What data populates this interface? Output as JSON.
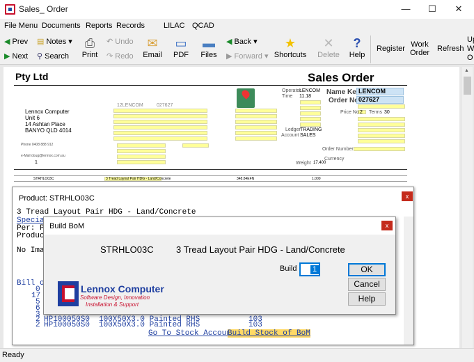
{
  "window": {
    "title": "Sales_ Order",
    "minimize": "—",
    "maximize": "☐",
    "close": "✕"
  },
  "menu": [
    "File Menu",
    "Documents",
    "Reports",
    "Records",
    "LILAC",
    "QCAD"
  ],
  "toolbar": {
    "prev": "Prev",
    "next": "Next",
    "notes": "Notes",
    "search": "Search",
    "print": "Print",
    "undo": "Undo",
    "redo": "Redo",
    "email": "Email",
    "pdf": "PDF",
    "files": "Files",
    "back": "Back",
    "forward": "Forward",
    "shortcuts": "Shortcuts",
    "delete": "Delete",
    "help": "Help",
    "register": "Register",
    "work_order_1": "Work",
    "work_order_2": "Order",
    "refresh": "Refresh",
    "upload_1": "Up",
    "upload_2": "W",
    "upload_3": "O"
  },
  "document": {
    "company": "Pty Ltd",
    "doc_title": "Sales Order",
    "name_key_label": "Name Key",
    "name_key": "LENCOM",
    "order_no_label": "Order No",
    "order_no": "027627",
    "operator_label": "Operator",
    "operator": "LENCOM",
    "time_label": "Time",
    "time": "11.18",
    "customer_code": "12LENCOM",
    "customer_num": "027627",
    "customer_name": "Lennox Computer",
    "unit": "Unit 6",
    "street": "14 Ashtan Place",
    "suburb": "BANYO QLD 4014",
    "phone": "Phone 0408 888 912",
    "email": "e-Mail doug@lennox.com.au",
    "ledger_label": "Ledger",
    "ledger": "TRADING",
    "account_label": "Account",
    "account": "SALES",
    "price_no_label": "Price No",
    "price_no": "2",
    "terms_label": "Terms",
    "terms": "30",
    "order_number_label": "Order Number",
    "qty": "1",
    "currency_label": "Currency",
    "weight_label": "Weight",
    "weight": "17.400",
    "line_code": "STRHLO03C",
    "line_desc": "3 Tread Layout Pair HDG - Land/Concrete",
    "line_price": "348.84EFN",
    "line_total": "1.000"
  },
  "product_panel": {
    "title": "Product: STRHLO03C",
    "close": "x",
    "line1": "3 Tread Layout Pair HDG - Land/Concrete",
    "line2": "Special",
    "line3": "Per: PR",
    "line4": "Product",
    "line5": "No Imag",
    "bill_of": "Bill of",
    "row_a_qty": "0",
    "row_b_qty": "17",
    "row_c_qty": "5",
    "row_d_qty": "6",
    "row_e_qty": "3",
    "row_f_qty": "2",
    "row_g_qty": "2",
    "row_f_code": "HP100050S0",
    "row_f_desc": "100X50X3.0 Painted RHS",
    "row_f_num": "103",
    "row_g_code": "HP100050S0",
    "row_g_desc": "100X50X3.0 Painted RHS",
    "row_g_num": "103",
    "go_to_stock": "Go To Stock Account",
    "build_stock": "Build Stock of BoM"
  },
  "bom_dialog": {
    "title": "Build BoM",
    "close": "x",
    "code": "STRHLO03C",
    "description": "3 Tread Layout Pair HDG - Land/Concrete",
    "build_label": "Build",
    "build_value": "1",
    "ok": "OK",
    "cancel": "Cancel",
    "help": "Help"
  },
  "logo": {
    "name": "Lennox Computer",
    "tagline1": "Software Design, Innovation",
    "tagline2": "Installation & Support"
  },
  "status": "Ready",
  "colors": {
    "accent": "#0078d7",
    "close_red": "#c42b1c",
    "field_yellow": "#ffff99",
    "field_blue": "#cde3f5",
    "logo_blue": "#1f3fa0",
    "logo_red": "#c8102e"
  }
}
